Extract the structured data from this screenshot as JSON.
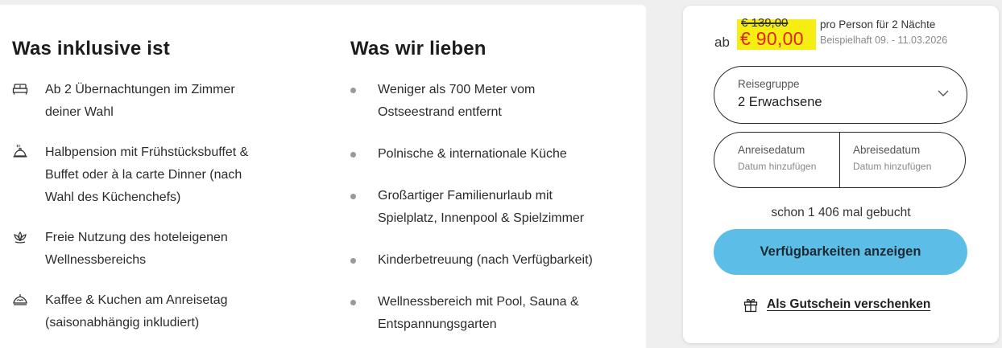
{
  "inclusive": {
    "title": "Was inklusive ist",
    "items": [
      {
        "icon": "bed-icon",
        "lines": [
          "Ab 2 Übernachtungen im Zimmer",
          "deiner Wahl"
        ]
      },
      {
        "icon": "food-cloche-icon",
        "lines": [
          "Halbpension mit Frühstücksbuffet &",
          "Buffet oder à la carte Dinner (nach",
          "Wahl des Küchenchefs)"
        ]
      },
      {
        "icon": "lotus-icon",
        "lines": [
          "Freie Nutzung des hoteleigenen",
          "Wellnessbereichs"
        ]
      },
      {
        "icon": "cake-icon",
        "lines": [
          "Kaffee & Kuchen am Anreisetag",
          "(saisonabhängig inkludiert)"
        ]
      }
    ]
  },
  "love": {
    "title": "Was wir lieben",
    "items": [
      {
        "lines": [
          "Weniger als 700 Meter vom",
          "Ostseestrand entfernt"
        ]
      },
      {
        "lines": [
          "Polnische & internationale Küche"
        ]
      },
      {
        "lines": [
          "Großartiger Familienurlaub mit",
          "Spielplatz, Innenpool & Spielzimmer"
        ]
      },
      {
        "lines": [
          "Kinderbetreuung (nach Verfügbarkeit)"
        ]
      },
      {
        "lines": [
          "Wellnessbereich mit Pool, Sauna &",
          "Entspannungsgarten"
        ]
      }
    ]
  },
  "booking": {
    "prefix": "ab",
    "old_price": "€ 139,00",
    "new_price": "€ 90,00",
    "per_person": "pro Person für 2 Nächte",
    "example": "Beispielhaft 09. - 11.03.2026",
    "group_label": "Reisegruppe",
    "group_value": "2 Erwachsene",
    "arrival_label": "Anreisedatum",
    "arrival_placeholder": "Datum hinzufügen",
    "departure_label": "Abreisedatum",
    "departure_placeholder": "Datum hinzufügen",
    "booked_text": "schon 1 406 mal gebucht",
    "cta_label": "Verfügbarkeiten anzeigen",
    "gift_label": "Als Gutschein verschenken",
    "colors": {
      "highlight": "#f6ee12",
      "new_price": "#e02424",
      "cta": "#5cbde6"
    }
  }
}
